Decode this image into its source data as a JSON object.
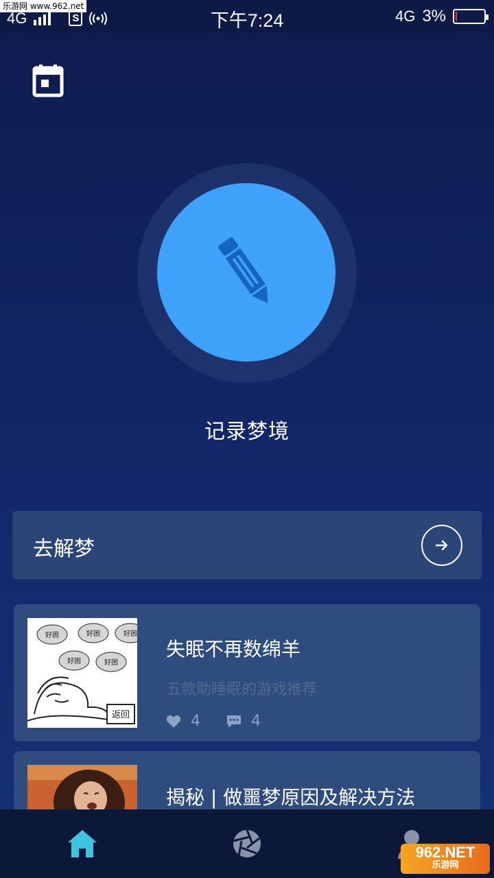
{
  "status_bar": {
    "watermark": "乐游网 www.962.net",
    "network": "4G",
    "s_icon": "S",
    "time": "下午7:24",
    "network_right": "4G",
    "battery_percent": "3%",
    "battery_level": 0.03,
    "battery_color": "#e53935"
  },
  "header": {
    "calendar_icon": "calendar-icon"
  },
  "record": {
    "icon": "pencil-icon",
    "label": "记录梦境",
    "color": "#3fa2fa"
  },
  "interpret": {
    "label": "去解梦",
    "icon": "arrow-right-circle-icon"
  },
  "articles": [
    {
      "title": "失眠不再数绵羊",
      "subtitle": "五款助睡眠的游戏推荐",
      "likes": "4",
      "comments": "4",
      "thumb_bubbles": [
        "好困",
        "好困",
        "好困",
        "好困",
        "好困",
        "好困"
      ],
      "thumb_sign": "返回"
    },
    {
      "title": "揭秘 | 做噩梦原因及解决方法"
    }
  ],
  "bottom_nav": {
    "items": [
      {
        "icon": "home-icon",
        "active": true
      },
      {
        "icon": "aperture-icon",
        "active": false
      },
      {
        "icon": "user-icon",
        "active": false
      }
    ],
    "active_color": "#3fc3e0",
    "watermark_line1": "962.NET",
    "watermark_line2": "乐游网"
  }
}
